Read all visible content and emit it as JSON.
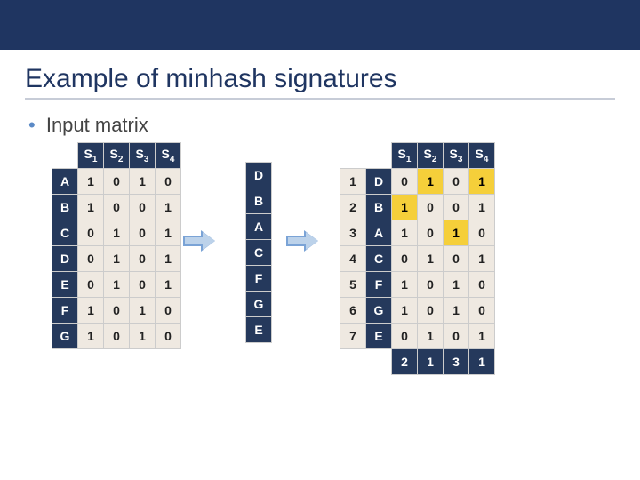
{
  "title": "Example of minhash signatures",
  "subtitle": "Input matrix",
  "col_headers": [
    "S1",
    "S2",
    "S3",
    "S4"
  ],
  "left_table": {
    "rows": [
      "A",
      "B",
      "C",
      "D",
      "E",
      "F",
      "G"
    ],
    "values": [
      [
        1,
        0,
        1,
        0
      ],
      [
        1,
        0,
        0,
        1
      ],
      [
        0,
        1,
        0,
        1
      ],
      [
        0,
        1,
        0,
        1
      ],
      [
        0,
        1,
        0,
        1
      ],
      [
        1,
        0,
        1,
        0
      ],
      [
        1,
        0,
        1,
        0
      ]
    ]
  },
  "permutation": [
    "D",
    "B",
    "A",
    "C",
    "F",
    "G",
    "E"
  ],
  "right_table": {
    "idx": [
      1,
      2,
      3,
      4,
      5,
      6,
      7
    ],
    "rows": [
      "D",
      "B",
      "A",
      "C",
      "F",
      "G",
      "E"
    ],
    "values": [
      [
        0,
        1,
        0,
        1
      ],
      [
        1,
        0,
        0,
        1
      ],
      [
        1,
        0,
        1,
        0
      ],
      [
        0,
        1,
        0,
        1
      ],
      [
        1,
        0,
        1,
        0
      ],
      [
        1,
        0,
        1,
        0
      ],
      [
        0,
        1,
        0,
        1
      ]
    ],
    "highlights": {
      "0": [
        1,
        3
      ],
      "1": [
        0
      ],
      "2": [
        2
      ]
    }
  },
  "signature": [
    2,
    1,
    3,
    1
  ],
  "chart_data": {
    "type": "table",
    "title": "Example of minhash signatures",
    "input_matrix": {
      "columns": [
        "S1",
        "S2",
        "S3",
        "S4"
      ],
      "rows": [
        "A",
        "B",
        "C",
        "D",
        "E",
        "F",
        "G"
      ],
      "data": [
        [
          1,
          0,
          1,
          0
        ],
        [
          1,
          0,
          0,
          1
        ],
        [
          0,
          1,
          0,
          1
        ],
        [
          0,
          1,
          0,
          1
        ],
        [
          0,
          1,
          0,
          1
        ],
        [
          1,
          0,
          1,
          0
        ],
        [
          1,
          0,
          1,
          0
        ]
      ]
    },
    "row_permutation": [
      "D",
      "B",
      "A",
      "C",
      "F",
      "G",
      "E"
    ],
    "permuted_matrix": {
      "index": [
        1,
        2,
        3,
        4,
        5,
        6,
        7
      ],
      "rows": [
        "D",
        "B",
        "A",
        "C",
        "F",
        "G",
        "E"
      ],
      "columns": [
        "S1",
        "S2",
        "S3",
        "S4"
      ],
      "data": [
        [
          0,
          1,
          0,
          1
        ],
        [
          1,
          0,
          0,
          1
        ],
        [
          1,
          0,
          1,
          0
        ],
        [
          0,
          1,
          0,
          1
        ],
        [
          1,
          0,
          1,
          0
        ],
        [
          1,
          0,
          1,
          0
        ],
        [
          0,
          1,
          0,
          1
        ]
      ],
      "first_one_highlights": {
        "S1": {
          "row_index": 2,
          "value_row": "B"
        },
        "S2": {
          "row_index": 1,
          "value_row": "D"
        },
        "S3": {
          "row_index": 3,
          "value_row": "A"
        },
        "S4": {
          "row_index": 1,
          "value_row": "D"
        }
      }
    },
    "minhash_signature": {
      "S1": 2,
      "S2": 1,
      "S3": 3,
      "S4": 1
    }
  }
}
